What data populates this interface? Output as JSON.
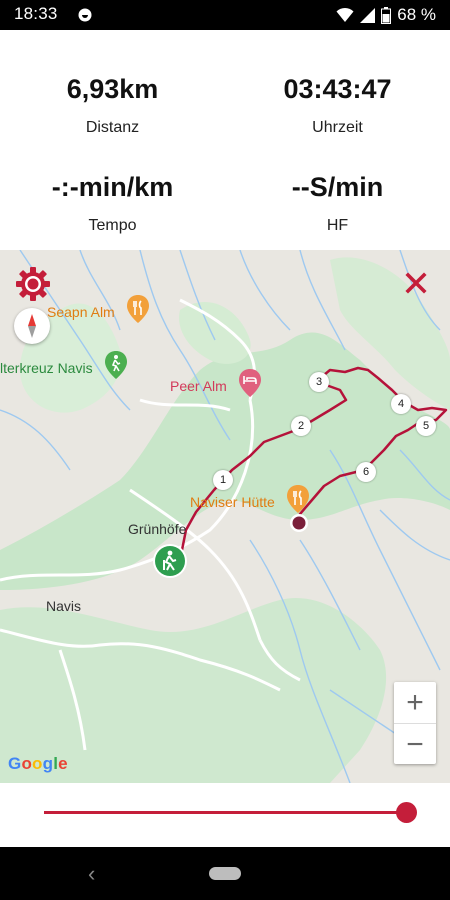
{
  "status_bar": {
    "time": "18:33",
    "battery_percent": "68 %"
  },
  "stats": {
    "distance": {
      "value": "6,93km",
      "label": "Distanz"
    },
    "time": {
      "value": "03:43:47",
      "label": "Uhrzeit"
    },
    "pace": {
      "value": "-:-min/km",
      "label": "Tempo"
    },
    "heart_rate": {
      "value": "--S/min",
      "label": "HF"
    }
  },
  "map": {
    "labels": {
      "seapn_alm": "Seapn Alm",
      "gipfelkreuz": "lterkreuz Navis",
      "peer_alm": "Peer Alm",
      "naviser_huette": "Naviser Hütte",
      "gruenhoefe": "Grünhöfe",
      "navis": "Navis"
    },
    "waypoints": [
      "1",
      "2",
      "3",
      "4",
      "5",
      "6"
    ],
    "zoom_in": "+",
    "zoom_out": "−",
    "attribution": [
      "G",
      "o",
      "o",
      "g",
      "l",
      "e"
    ],
    "route_color": "#b5123a"
  },
  "slider": {
    "progress": 1.0
  },
  "icons": [
    "app-notification-icon",
    "wifi-icon",
    "signal-icon",
    "battery-icon",
    "settings-gear-icon",
    "close-icon",
    "compass-icon",
    "restaurant-icon",
    "hiking-icon",
    "hotel-icon",
    "back-icon",
    "home-icon"
  ]
}
